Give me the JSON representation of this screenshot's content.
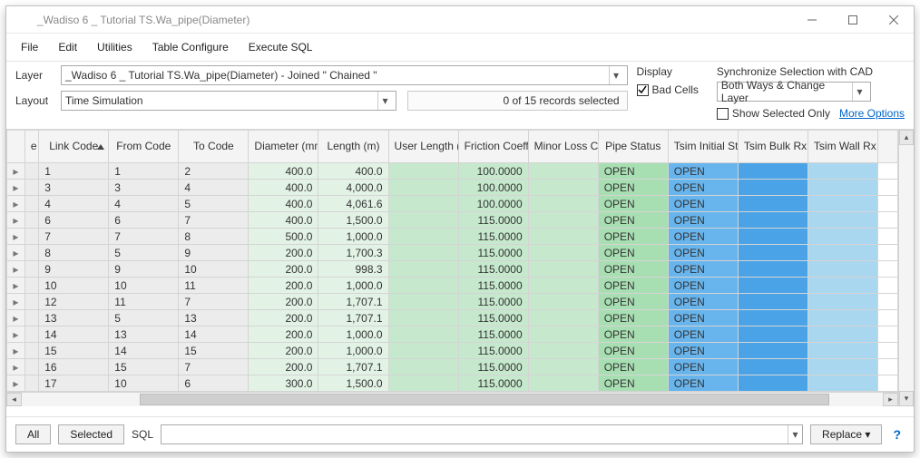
{
  "title": "_Wadiso 6 _ Tutorial TS.Wa_pipe(Diameter)",
  "menu": [
    "File",
    "Edit",
    "Utilities",
    "Table Configure",
    "Execute SQL"
  ],
  "toolbar": {
    "layer_label": "Layer",
    "layer_value": "_Wadiso 6 _ Tutorial TS.Wa_pipe(Diameter) - Joined \" Chained \"",
    "layout_label": "Layout",
    "layout_value": "Time Simulation",
    "selection_status": "0 of 15 records selected",
    "display_title": "Display",
    "bad_cells_label": "Bad Cells",
    "sync_title": "Synchronize Selection with CAD",
    "sync_value": "Both Ways & Change Layer",
    "sso_label": "Show Selected Only",
    "more_options": "More Options"
  },
  "columns": [
    {
      "key": "e",
      "label": "e"
    },
    {
      "key": "link",
      "label": "Link Code",
      "sort": "asc"
    },
    {
      "key": "from",
      "label": "From Code"
    },
    {
      "key": "to",
      "label": "To Code"
    },
    {
      "key": "dia",
      "label": "Diameter (mm)"
    },
    {
      "key": "len",
      "label": "Length (m)"
    },
    {
      "key": "ulen",
      "label": "User Length (m)"
    },
    {
      "key": "fric",
      "label": "Friction Coefficient"
    },
    {
      "key": "minor",
      "label": "Minor Loss Coefficient"
    },
    {
      "key": "stat",
      "label": "Pipe Status"
    },
    {
      "key": "tstat",
      "label": "Tsim Initial Status"
    },
    {
      "key": "bulk",
      "label": "Tsim Bulk Rx Coefficient"
    },
    {
      "key": "wall",
      "label": "Tsim Wall Rx Coefficient"
    }
  ],
  "rows": [
    {
      "link": "1",
      "from": "1",
      "to": "2",
      "dia": "400.0",
      "len": "400.0",
      "ulen": "",
      "fric": "100.0000",
      "minor": "",
      "stat": "OPEN",
      "tstat": "OPEN"
    },
    {
      "link": "3",
      "from": "3",
      "to": "4",
      "dia": "400.0",
      "len": "4,000.0",
      "ulen": "",
      "fric": "100.0000",
      "minor": "",
      "stat": "OPEN",
      "tstat": "OPEN"
    },
    {
      "link": "4",
      "from": "4",
      "to": "5",
      "dia": "400.0",
      "len": "4,061.6",
      "ulen": "",
      "fric": "100.0000",
      "minor": "",
      "stat": "OPEN",
      "tstat": "OPEN"
    },
    {
      "link": "6",
      "from": "6",
      "to": "7",
      "dia": "400.0",
      "len": "1,500.0",
      "ulen": "",
      "fric": "115.0000",
      "minor": "",
      "stat": "OPEN",
      "tstat": "OPEN"
    },
    {
      "link": "7",
      "from": "7",
      "to": "8",
      "dia": "500.0",
      "len": "1,000.0",
      "ulen": "",
      "fric": "115.0000",
      "minor": "",
      "stat": "OPEN",
      "tstat": "OPEN"
    },
    {
      "link": "8",
      "from": "5",
      "to": "9",
      "dia": "200.0",
      "len": "1,700.3",
      "ulen": "",
      "fric": "115.0000",
      "minor": "",
      "stat": "OPEN",
      "tstat": "OPEN"
    },
    {
      "link": "9",
      "from": "9",
      "to": "10",
      "dia": "200.0",
      "len": "998.3",
      "ulen": "",
      "fric": "115.0000",
      "minor": "",
      "stat": "OPEN",
      "tstat": "OPEN"
    },
    {
      "link": "10",
      "from": "10",
      "to": "11",
      "dia": "200.0",
      "len": "1,000.0",
      "ulen": "",
      "fric": "115.0000",
      "minor": "",
      "stat": "OPEN",
      "tstat": "OPEN"
    },
    {
      "link": "12",
      "from": "11",
      "to": "7",
      "dia": "200.0",
      "len": "1,707.1",
      "ulen": "",
      "fric": "115.0000",
      "minor": "",
      "stat": "OPEN",
      "tstat": "OPEN"
    },
    {
      "link": "13",
      "from": "5",
      "to": "13",
      "dia": "200.0",
      "len": "1,707.1",
      "ulen": "",
      "fric": "115.0000",
      "minor": "",
      "stat": "OPEN",
      "tstat": "OPEN"
    },
    {
      "link": "14",
      "from": "13",
      "to": "14",
      "dia": "200.0",
      "len": "1,000.0",
      "ulen": "",
      "fric": "115.0000",
      "minor": "",
      "stat": "OPEN",
      "tstat": "OPEN"
    },
    {
      "link": "15",
      "from": "14",
      "to": "15",
      "dia": "200.0",
      "len": "1,000.0",
      "ulen": "",
      "fric": "115.0000",
      "minor": "",
      "stat": "OPEN",
      "tstat": "OPEN"
    },
    {
      "link": "16",
      "from": "15",
      "to": "7",
      "dia": "200.0",
      "len": "1,707.1",
      "ulen": "",
      "fric": "115.0000",
      "minor": "",
      "stat": "OPEN",
      "tstat": "OPEN"
    },
    {
      "link": "17",
      "from": "10",
      "to": "6",
      "dia": "300.0",
      "len": "1,500.0",
      "ulen": "",
      "fric": "115.0000",
      "minor": "",
      "stat": "OPEN",
      "tstat": "OPEN"
    }
  ],
  "bottombar": {
    "all": "All",
    "selected": "Selected",
    "sql_label": "SQL",
    "replace": "Replace",
    "help": "?"
  }
}
